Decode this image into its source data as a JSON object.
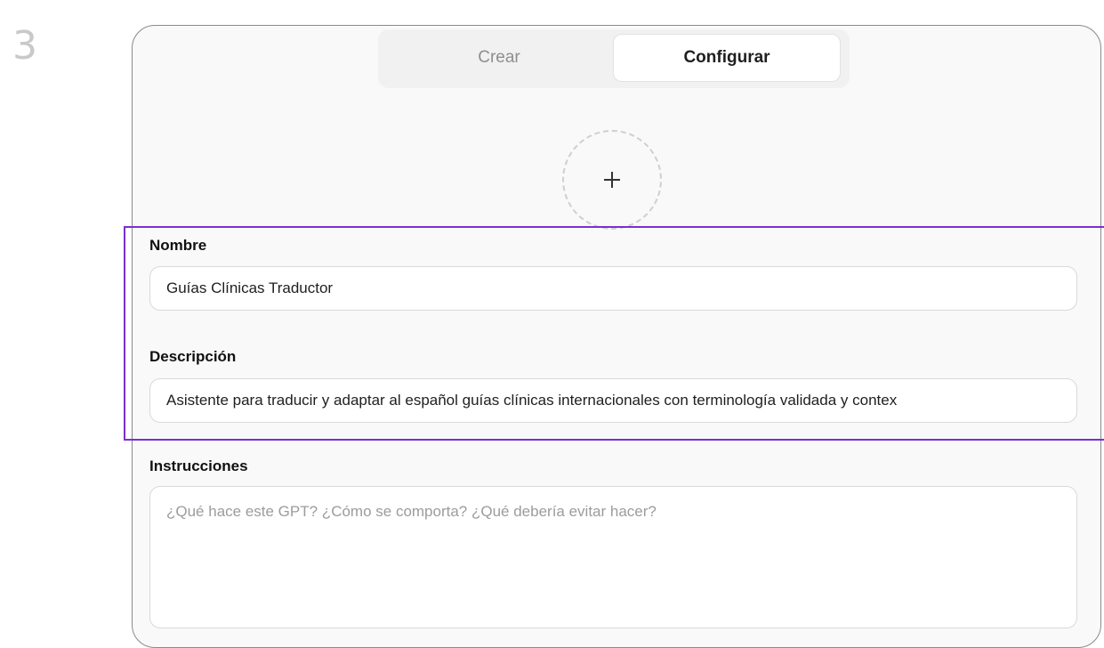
{
  "step": {
    "number": "3"
  },
  "tabs": [
    {
      "label": "Crear"
    },
    {
      "label": "Configurar"
    }
  ],
  "icons": {
    "upload": "plus-icon"
  },
  "form": {
    "name": {
      "label": "Nombre",
      "value": "Guías Clínicas Traductor"
    },
    "description": {
      "label": "Descripción",
      "value": "Asistente para traducir y adaptar al español guías clínicas internacionales con terminología validada y contex"
    },
    "instructions": {
      "label": "Instrucciones",
      "placeholder": "¿Qué hace este GPT? ¿Cómo se comporta? ¿Qué debería evitar hacer?"
    }
  },
  "colors": {
    "highlight": "#7b2fd0",
    "panel_border": "#8a8a8a",
    "step_number": "#c9c9c9"
  }
}
